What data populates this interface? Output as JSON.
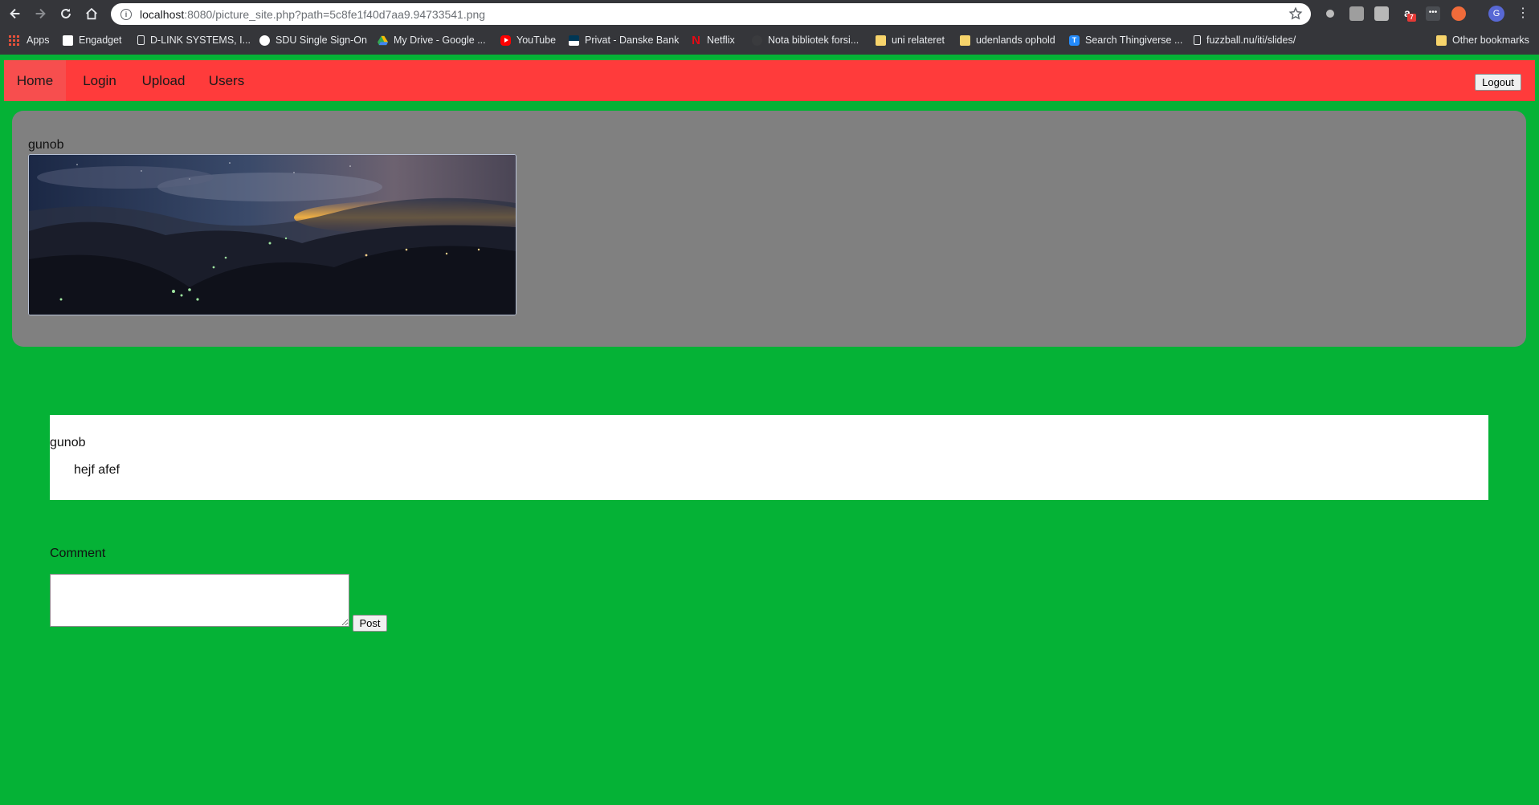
{
  "browser": {
    "url_host": "localhost",
    "url_rest": ":8080/picture_site.php?path=5c8fe1f40d7aa9.94733541.png",
    "profile_initial": "G",
    "ext_badge": "7",
    "bookmarks": [
      {
        "label": "Apps",
        "icon": "apps-grid-icon"
      },
      {
        "label": "Engadget",
        "icon": "engadget-icon"
      },
      {
        "label": "D-LINK SYSTEMS, I...",
        "icon": "page-icon"
      },
      {
        "label": "SDU Single Sign-On",
        "icon": "sdu-icon"
      },
      {
        "label": "My Drive - Google ...",
        "icon": "google-drive-icon"
      },
      {
        "label": "YouTube",
        "icon": "youtube-icon"
      },
      {
        "label": "Privat - Danske Bank",
        "icon": "danske-bank-icon"
      },
      {
        "label": "Netflix",
        "icon": "netflix-icon"
      },
      {
        "label": "Nota bibliotek forsi...",
        "icon": "nota-icon"
      },
      {
        "label": "uni relateret",
        "icon": "folder-icon"
      },
      {
        "label": "udenlands ophold",
        "icon": "folder-icon"
      },
      {
        "label": "Search Thingiverse ...",
        "icon": "thingiverse-icon"
      },
      {
        "label": "fuzzball.nu/iti/slides/",
        "icon": "page-icon"
      },
      {
        "label": "Other bookmarks",
        "icon": "folder-icon"
      }
    ]
  },
  "nav": {
    "items": [
      {
        "label": "Home",
        "active": true
      },
      {
        "label": "Login"
      },
      {
        "label": "Upload"
      },
      {
        "label": "Users"
      }
    ],
    "logout_label": "Logout"
  },
  "post": {
    "author": "gunob",
    "image_alt": "night-mountain-landscape"
  },
  "comments": [
    {
      "author": "gunob",
      "text": "hejf afef"
    }
  ],
  "comment_form": {
    "label": "Comment",
    "value": "",
    "post_label": "Post"
  },
  "colors": {
    "page_bg": "#05b236",
    "nav_bg": "#ff3b3b",
    "nav_active_bg": "#f74e4e",
    "card_bg": "#808080"
  }
}
